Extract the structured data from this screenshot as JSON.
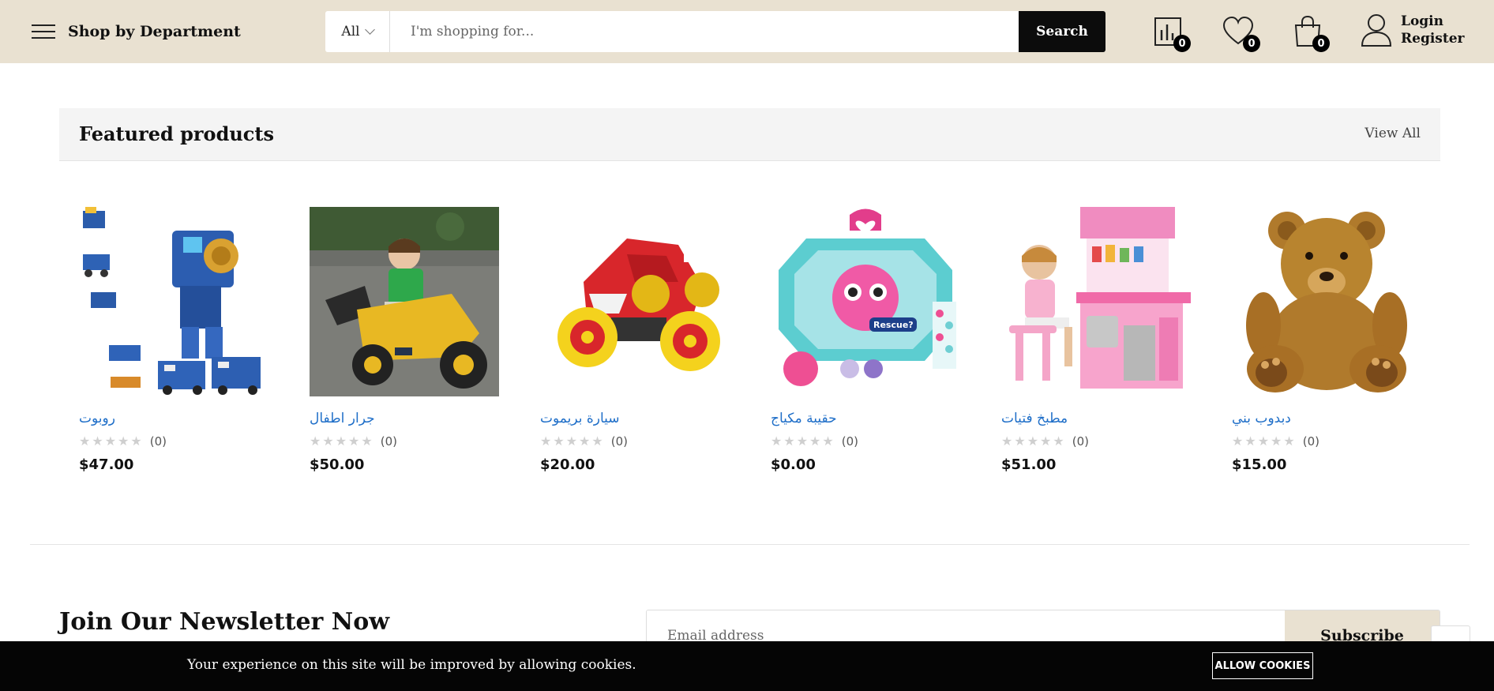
{
  "header": {
    "department_label": "Shop by Department",
    "search": {
      "category": "All",
      "placeholder": "I'm shopping for...",
      "button_label": "Search"
    },
    "compare_count": "0",
    "wishlist_count": "0",
    "cart_count": "0",
    "login_label": "Login",
    "register_label": "Register"
  },
  "featured": {
    "title": "Featured products",
    "view_all": "View All",
    "products": [
      {
        "name": "روبوت",
        "rating_count": "(0)",
        "price": "$47.00",
        "rating": 0
      },
      {
        "name": "جرار اطفال",
        "rating_count": "(0)",
        "price": "$50.00",
        "rating": 0
      },
      {
        "name": "سيارة بريموت",
        "rating_count": "(0)",
        "price": "$20.00",
        "rating": 0
      },
      {
        "name": "حقيبة مكياج",
        "rating_count": "(0)",
        "price": "$0.00",
        "rating": 0
      },
      {
        "name": "مطبخ فتيات",
        "rating_count": "(0)",
        "price": "$51.00",
        "rating": 0
      },
      {
        "name": "دبدوب بني",
        "rating_count": "(0)",
        "price": "$15.00",
        "rating": 0
      }
    ]
  },
  "newsletter": {
    "title": "Join Our Newsletter Now",
    "email_placeholder": "Email address",
    "subscribe_label": "Subscribe"
  },
  "cookie": {
    "message": "Your experience on this site will be improved by allowing cookies.",
    "button_label": "ALLOW COOKIES"
  },
  "colors": {
    "header_bg": "#e9e1d1",
    "accent_dark": "#0c0c0c",
    "link_blue": "#1e6ec8"
  }
}
